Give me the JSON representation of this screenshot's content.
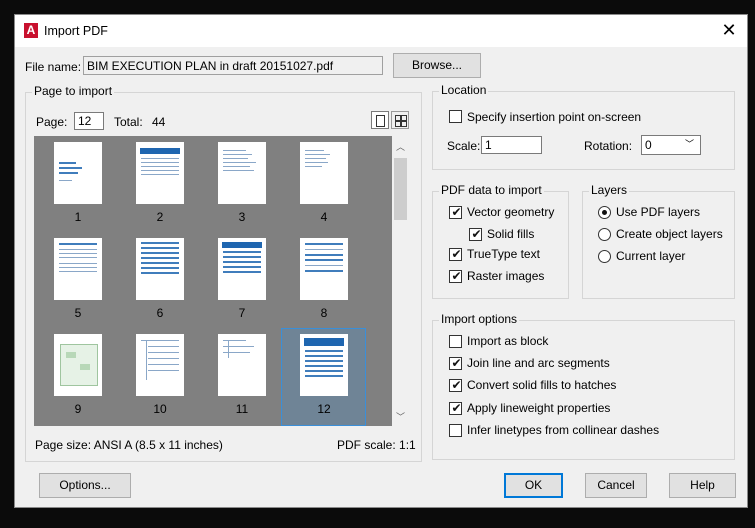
{
  "title": "Import PDF",
  "close_glyph": "✕",
  "app_icon_letter": "A",
  "file": {
    "label": "File name:",
    "value": "BIM EXECUTION PLAN in draft 20151027.pdf",
    "browse": "Browse..."
  },
  "page_to_import": {
    "title": "Page to import",
    "page_label": "Page:",
    "page_value": "12",
    "total_label": "Total:",
    "total_value": "44",
    "thumbnails": [
      "1",
      "2",
      "3",
      "4",
      "5",
      "6",
      "7",
      "8",
      "9",
      "10",
      "11",
      "12"
    ],
    "selected_page": "12",
    "page_size": "Page size:  ANSI A (8.5 x 11 inches)",
    "pdf_scale": "PDF scale:  1:1"
  },
  "location": {
    "title": "Location",
    "specify_label": "Specify insertion point on-screen",
    "specify_checked": false,
    "scale_label": "Scale:",
    "scale_value": "1",
    "rotation_label": "Rotation:",
    "rotation_value": "0"
  },
  "pdf_data": {
    "title": "PDF data to import",
    "items": [
      {
        "label": "Vector geometry",
        "checked": true
      },
      {
        "label": "Solid fills",
        "checked": true
      },
      {
        "label": "TrueType text",
        "checked": true
      },
      {
        "label": "Raster images",
        "checked": true
      }
    ]
  },
  "layers": {
    "title": "Layers",
    "options": [
      {
        "label": "Use PDF layers",
        "selected": true
      },
      {
        "label": "Create object layers",
        "selected": false
      },
      {
        "label": "Current layer",
        "selected": false
      }
    ]
  },
  "import_options": {
    "title": "Import options",
    "items": [
      {
        "label": "Import as block",
        "checked": false
      },
      {
        "label": "Join line and arc segments",
        "checked": true
      },
      {
        "label": "Convert solid fills to hatches",
        "checked": true
      },
      {
        "label": "Apply lineweight properties",
        "checked": true
      },
      {
        "label": "Infer linetypes from collinear dashes",
        "checked": false
      }
    ]
  },
  "buttons": {
    "options": "Options...",
    "ok": "OK",
    "cancel": "Cancel",
    "help": "Help"
  },
  "check_glyph": "✔",
  "accent_color": "#0078d7"
}
